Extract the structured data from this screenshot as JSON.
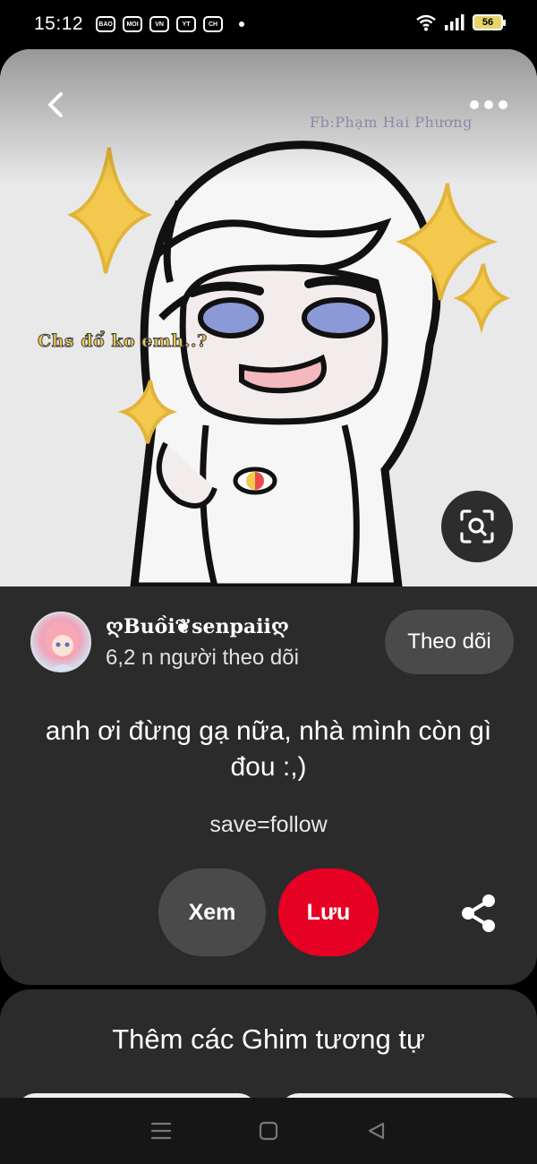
{
  "status_bar": {
    "time": "15:12",
    "app_icons": [
      "BAO",
      "MOI",
      "VN",
      "YT",
      "CH"
    ],
    "battery": "56"
  },
  "pin": {
    "image_watermark": "Fb:Phạm Hai Phương",
    "image_caption": "Chs đổ ko emh..?",
    "creator_name": "ღBuồi❦senpaiiღ",
    "creator_followers": "6,2 n người theo dõi",
    "follow_label": "Theo dõi",
    "title": "anh ơi đừng gạ nữa, nhà mình còn gì đou :,)",
    "description": "save=follow",
    "view_label": "Xem",
    "save_label": "Lưu"
  },
  "related": {
    "title": "Thêm các Ghim tương tự"
  },
  "colors": {
    "save_button": "#e60023",
    "card_background": "#2b2b2b",
    "secondary_button": "#4a4a4a"
  },
  "icons": [
    "back-icon",
    "more-icon",
    "visual-search-icon",
    "share-icon",
    "nav-menu-icon",
    "nav-home-icon",
    "nav-back-icon"
  ]
}
